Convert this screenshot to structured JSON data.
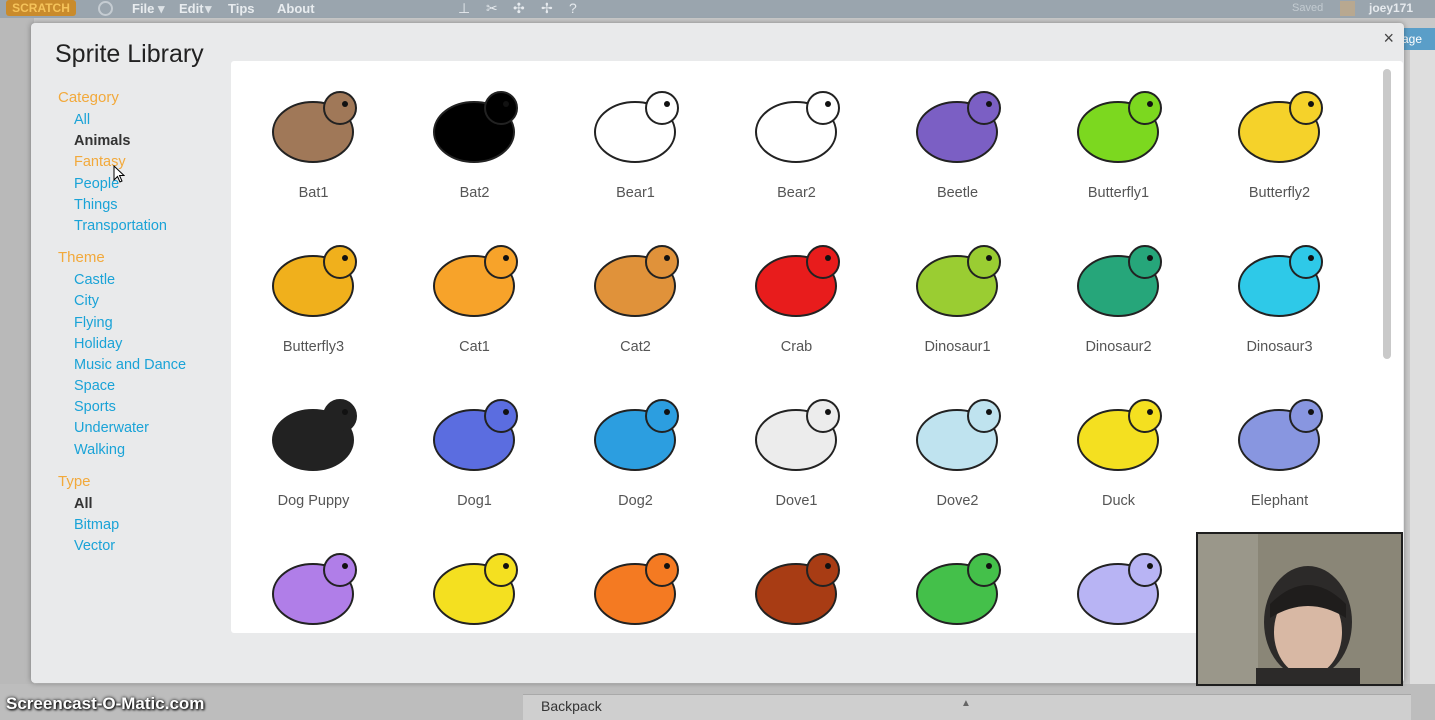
{
  "editor": {
    "logo": "SCRATCH",
    "menu": [
      "File",
      "Edit",
      "Tips",
      "About"
    ],
    "saved": "Saved",
    "username": "joey171",
    "stage_button": "age",
    "backpack": "Backpack"
  },
  "modal": {
    "title": "Sprite Library",
    "close": "×"
  },
  "sidebar": {
    "category_heading": "Category",
    "category": [
      "All",
      "Animals",
      "Fantasy",
      "People",
      "Things",
      "Transportation"
    ],
    "theme_heading": "Theme",
    "theme": [
      "Castle",
      "City",
      "Flying",
      "Holiday",
      "Music and Dance",
      "Space",
      "Sports",
      "Underwater",
      "Walking"
    ],
    "type_heading": "Type",
    "type": [
      "All",
      "Bitmap",
      "Vector"
    ]
  },
  "sprites": [
    {
      "name": "Bat1",
      "color": "#a07858"
    },
    {
      "name": "Bat2",
      "color": "#000000"
    },
    {
      "name": "Bear1",
      "color": "#ffffff"
    },
    {
      "name": "Bear2",
      "color": "#ffffff"
    },
    {
      "name": "Beetle",
      "color": "#7b5fc4"
    },
    {
      "name": "Butterfly1",
      "color": "#7cd81f"
    },
    {
      "name": "Butterfly2",
      "color": "#f5d22a"
    },
    {
      "name": "Butterfly3",
      "color": "#f0b01c"
    },
    {
      "name": "Cat1",
      "color": "#f7a32a"
    },
    {
      "name": "Cat2",
      "color": "#e0923a"
    },
    {
      "name": "Crab",
      "color": "#e81c1c"
    },
    {
      "name": "Dinosaur1",
      "color": "#9acd32"
    },
    {
      "name": "Dinosaur2",
      "color": "#26a67a"
    },
    {
      "name": "Dinosaur3",
      "color": "#2ec9e8"
    },
    {
      "name": "Dog Puppy",
      "color": "#222222"
    },
    {
      "name": "Dog1",
      "color": "#5b6de0"
    },
    {
      "name": "Dog2",
      "color": "#2c9ee0"
    },
    {
      "name": "Dove1",
      "color": "#ececec"
    },
    {
      "name": "Dove2",
      "color": "#bfe3ef"
    },
    {
      "name": "Duck",
      "color": "#f4e020"
    },
    {
      "name": "Elephant",
      "color": "#8896e0"
    },
    {
      "name": "",
      "color": "#b07ee8"
    },
    {
      "name": "",
      "color": "#f4e020"
    },
    {
      "name": "",
      "color": "#f47a22"
    },
    {
      "name": "",
      "color": "#a83c14"
    },
    {
      "name": "",
      "color": "#44c04a"
    },
    {
      "name": "",
      "color": "#b8b4f4"
    }
  ],
  "watermark": "Screencast-O-Matic.com"
}
